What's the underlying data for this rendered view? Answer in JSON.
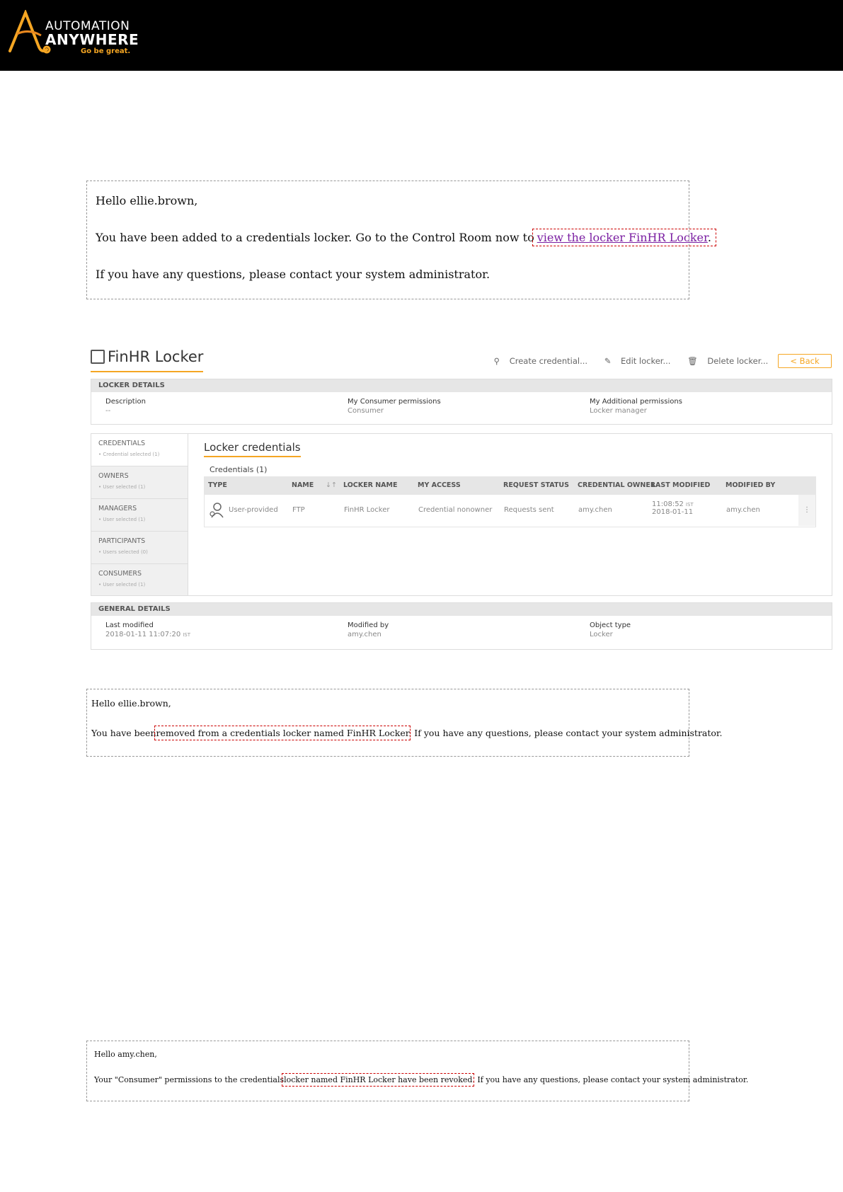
{
  "header": {
    "logo_line1": "AUTOMATION",
    "logo_line2": "ANYWHERE",
    "tagline": "Go be great.",
    "brand_color": "#f5a623"
  },
  "email1": {
    "greeting": "Hello ellie.brown,",
    "line_prefix": "You have been added to a credentials locker. Go to the Control Room now to",
    "link_text": "view the locker FinHR Locker",
    "line_suffix": ".",
    "closing": "If you have any questions, please contact your system administrator."
  },
  "locker": {
    "title": "FinHR Locker",
    "actions": {
      "create": "Create credential...",
      "edit": "Edit locker...",
      "delete": "Delete locker...",
      "back": "< Back"
    },
    "details_header": "LOCKER DETAILS",
    "description_label": "Description",
    "description_value": "--",
    "consumer_perm_label": "My Consumer permissions",
    "consumer_perm_value": "Consumer",
    "additional_perm_label": "My Additional permissions",
    "additional_perm_value": "Locker manager",
    "sidebar": [
      {
        "title": "CREDENTIALS",
        "sub": "• Credential selected (1)"
      },
      {
        "title": "OWNERS",
        "sub": "• User selected (1)"
      },
      {
        "title": "MANAGERS",
        "sub": "• User selected (1)"
      },
      {
        "title": "PARTICIPANTS",
        "sub": "• Users selected (0)"
      },
      {
        "title": "CONSUMERS",
        "sub": "• User selected (1)"
      }
    ],
    "section_title": "Locker credentials",
    "credentials_count": "Credentials (1)",
    "columns": [
      "TYPE",
      "NAME",
      "LOCKER NAME",
      "MY ACCESS",
      "REQUEST STATUS",
      "CREDENTIAL OWNER",
      "LAST MODIFIED",
      "MODIFIED BY"
    ],
    "row": {
      "type": "User-provided",
      "name": "FTP",
      "locker_name": "FinHR Locker",
      "access": "Credential nonowner",
      "status": "Requests sent",
      "owner": "amy.chen",
      "modified_time": "11:08:52",
      "modified_tz": "IST",
      "modified_date": "2018-01-11",
      "modified_by": "amy.chen"
    },
    "general_header": "GENERAL DETAILS",
    "last_modified_label": "Last modified",
    "last_modified_value": "2018-01-11 11:07:20",
    "last_modified_tz": "IST",
    "modified_by_label": "Modified by",
    "modified_by_value": "amy.chen",
    "object_type_label": "Object type",
    "object_type_value": "Locker"
  },
  "email2": {
    "greeting": "Hello ellie.brown,",
    "prefix": "You have been",
    "highlight": "removed from a credentials locker named FinHR Locker",
    "suffix": ". If you have any questions, please contact your system administrator."
  },
  "email3": {
    "greeting": "Hello amy.chen,",
    "prefix": "Your \"Consumer\" permissions to the credentials",
    "highlight": "locker named FinHR Locker have been revoked",
    "suffix": ". If you have any questions, please contact your system administrator."
  }
}
